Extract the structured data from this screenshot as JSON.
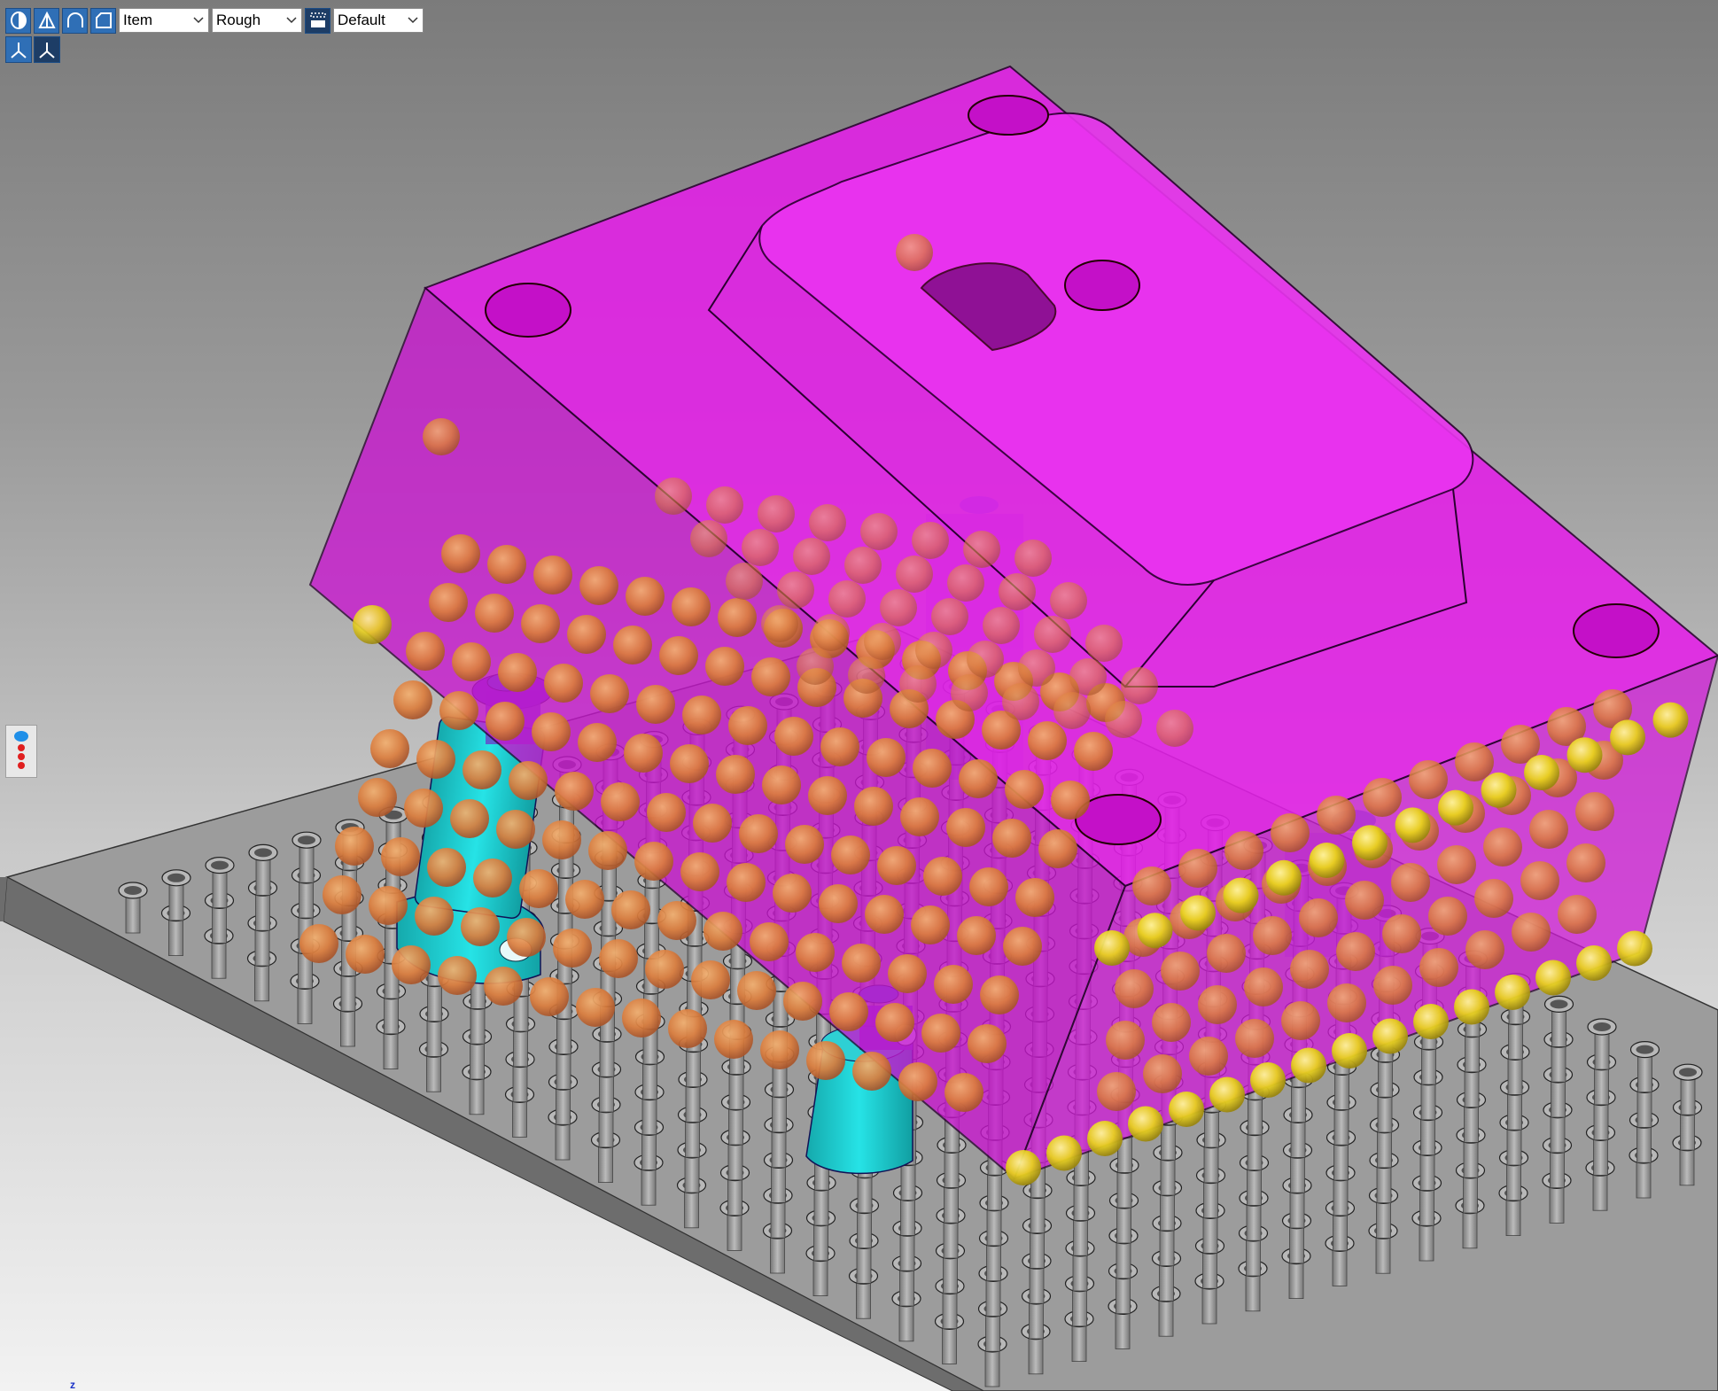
{
  "toolbar": {
    "shading_modes": [
      {
        "icon": "shaded-mode-icon"
      },
      {
        "icon": "hidden-line-mode-icon"
      },
      {
        "icon": "wireframe-mode-icon"
      },
      {
        "icon": "silhouette-mode-icon"
      }
    ],
    "selection_filter": {
      "value": "Item"
    },
    "quality": {
      "value": "Rough"
    },
    "view_style_icon": "render-style-icon",
    "view_style": {
      "value": "Default"
    },
    "row2": [
      {
        "icon": "axes-triad-icon"
      },
      {
        "icon": "axes-orientation-icon"
      }
    ]
  },
  "side_widget": {
    "icon": "point-cloud-legend-icon"
  },
  "axis": {
    "z_label": "z"
  },
  "colors": {
    "part": "#e020e8",
    "fixture": "#1fd4d8",
    "plate": "#8a8a8a",
    "sphere_orange": "#e08040",
    "sphere_yellow": "#e8d020"
  }
}
